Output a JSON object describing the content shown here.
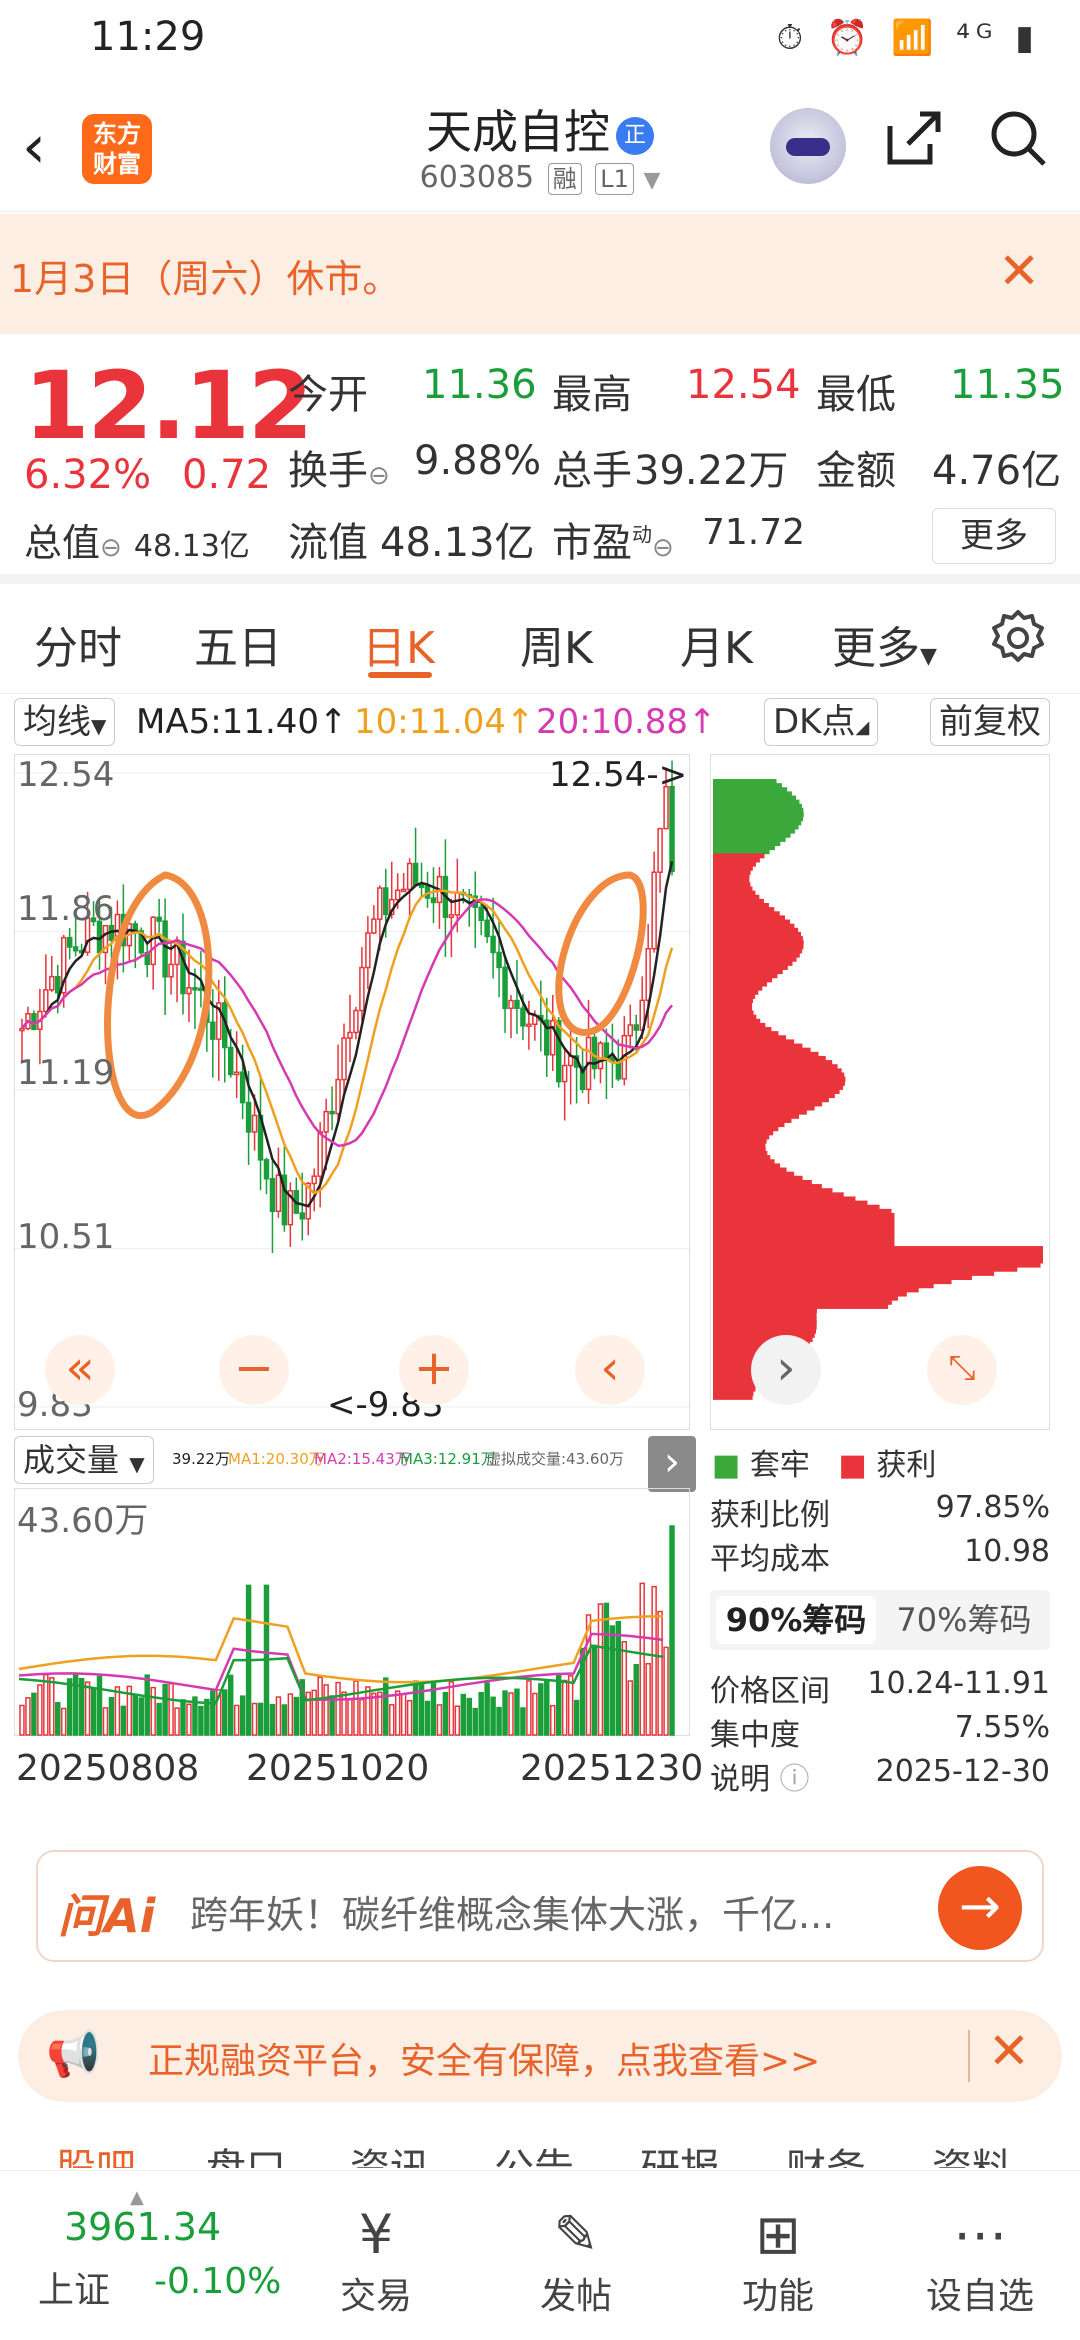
{
  "status_bar": {
    "time": "11:29",
    "icons": "⏱ ⏰ 📶 ⁴ᴳ ▮"
  },
  "header": {
    "app_logo": "东方财富",
    "stock_name": "天成自控",
    "name_badge": "正",
    "stock_code": "603085",
    "tag1": "融",
    "tag2": "L1"
  },
  "notice": {
    "text": "1月3日（周六）休市。"
  },
  "quote": {
    "price": "12.12",
    "change_pct": "6.32%",
    "change": "0.72",
    "mktcap_label": "总值",
    "mktcap_value": "48.13亿",
    "open_label": "今开",
    "open": "11.36",
    "high_label": "最高",
    "high": "12.54",
    "low_label": "最低",
    "low": "11.35",
    "turnover_label": "换手",
    "turnover": "9.88%",
    "volume_label": "总手",
    "volume": "39.22万",
    "amount_label": "金额",
    "amount": "4.76亿",
    "float_label": "流值",
    "float": "48.13亿",
    "pe_label": "市盈",
    "pe_sup": "动",
    "pe": "71.72",
    "more": "更多"
  },
  "tabs": [
    "分时",
    "五日",
    "日K",
    "周K",
    "月K",
    "更多"
  ],
  "active_tab": "日K",
  "toolbar": {
    "ma_select": "均线",
    "ma5": "MA5:11.40↑",
    "ma10": "10:11.04↑",
    "ma20": "20:10.88↑",
    "dk": "DK点",
    "adjust": "前复权"
  },
  "colors": {
    "up": "#e8343a",
    "down": "#1a9e3a",
    "ma5": "#222222",
    "ma10": "#f0a020",
    "ma20": "#d63ab0",
    "accent": "#e8632a"
  },
  "chart_data": {
    "type": "candlestick",
    "y_ticks": [
      "12.54",
      "11.86",
      "11.19",
      "10.51",
      "9.83"
    ],
    "high_marker": "12.54->",
    "low_marker": "<-9.83",
    "x_labels": [
      "20250808",
      "20251020",
      "20251230"
    ],
    "ylim": [
      9.83,
      12.54
    ]
  },
  "chip": {
    "legend_trapped": "套牢",
    "legend_profit": "获利",
    "profit_ratio_label": "获利比例",
    "profit_ratio": "97.85%",
    "avg_cost_label": "平均成本",
    "avg_cost": "10.98",
    "seg_90": "90%筹码",
    "seg_70": "70%筹码",
    "range_label": "价格区间",
    "range": "10.24-11.91",
    "concentration_label": "集中度",
    "concentration": "7.55%",
    "note_label": "说明",
    "note": "2025-12-30"
  },
  "volume": {
    "select": "成交量",
    "legend": "39.22万",
    "ma1": "MA1:20.30万",
    "ma2": "MA2:15.43万",
    "ma3": "MA3:12.91万",
    "virtual": "虚拟成交量:43.60万",
    "max_label": "43.60万"
  },
  "ai": {
    "logo": "问Ai",
    "text": "跨年妖！碳纤维概念集体大涨，千亿..."
  },
  "ad": {
    "text": "正规融资平台，安全有保障，点我查看>>"
  },
  "bottom_tabs": [
    "股吧",
    "盘口",
    "资讯",
    "公告",
    "研报",
    "财务",
    "资料"
  ],
  "index": {
    "value": "3961.34",
    "name": "上证",
    "change": "-0.10%"
  },
  "nav": [
    {
      "label": "交易",
      "icon": "yen-circle-icon"
    },
    {
      "label": "发帖",
      "icon": "edit-icon"
    },
    {
      "label": "功能",
      "icon": "grid-icon"
    },
    {
      "label": "设自选",
      "icon": "more-circle-icon"
    }
  ]
}
